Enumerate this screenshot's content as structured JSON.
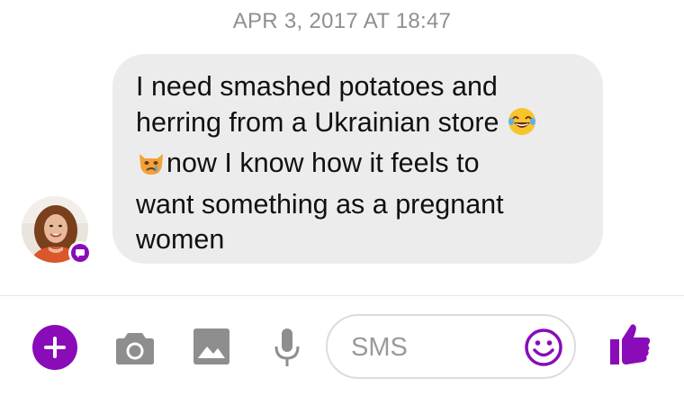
{
  "conversation": {
    "timestamp": "APR 3, 2017 AT 18:47",
    "message": {
      "line1": "I need smashed potatoes and",
      "line2": "herring from a Ukrainian store",
      "line3": "now I know how it feels to",
      "line4": "want something as a pregnant",
      "line5": "women"
    }
  },
  "composer": {
    "placeholder": "SMS"
  },
  "colors": {
    "accent": "#8a0bb8",
    "icon_gray": "#8e8e8e",
    "bubble": "#ececec"
  },
  "icons": [
    "plus-icon",
    "camera-icon",
    "image-icon",
    "microphone-icon",
    "emoji-icon",
    "thumbs-up-icon",
    "laughing-emoji",
    "crying-cat-emoji",
    "messenger-badge-icon"
  ]
}
